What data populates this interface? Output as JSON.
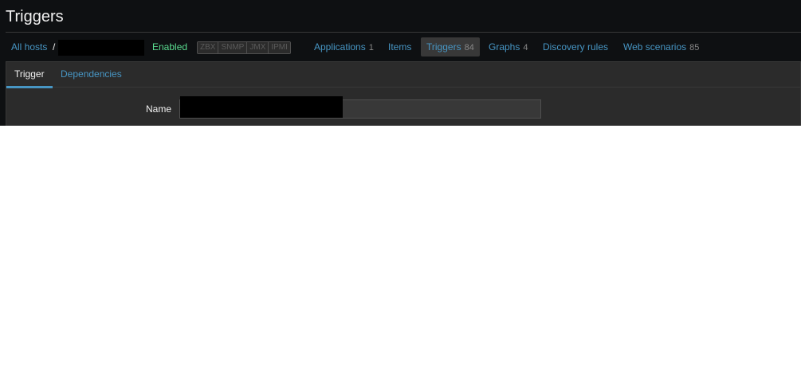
{
  "header": {
    "title": "Triggers"
  },
  "host_nav": {
    "all_hosts": "All hosts",
    "separator": "/",
    "host_name": "",
    "status": "Enabled",
    "availability": [
      "ZBX",
      "SNMP",
      "JMX",
      "IPMI"
    ],
    "items": [
      {
        "label": "Applications",
        "count": "1"
      },
      {
        "label": "Items",
        "count": ""
      },
      {
        "label": "Triggers",
        "count": "84",
        "selected": true
      },
      {
        "label": "Graphs",
        "count": "4"
      },
      {
        "label": "Discovery rules",
        "count": ""
      },
      {
        "label": "Web scenarios",
        "count": "85"
      }
    ]
  },
  "form": {
    "tabs": [
      {
        "label": "Trigger",
        "active": true
      },
      {
        "label": "Dependencies",
        "active": false
      }
    ],
    "name_label": "Name",
    "name_value": ""
  },
  "colors": {
    "background": "#0e1012",
    "panel": "#2b2b2b",
    "link": "#4796c4",
    "enabled": "#59db8f",
    "text": "#f2f2f2"
  }
}
